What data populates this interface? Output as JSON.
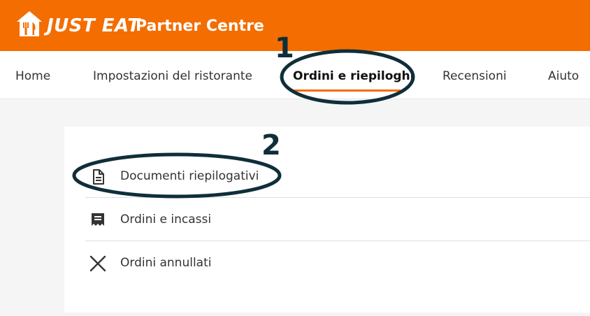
{
  "header": {
    "brand": "JUST EAT",
    "product": "Partner Centre",
    "logo_icon": "house-fork-knife-icon",
    "background_color": "#f36d00"
  },
  "nav": {
    "items": [
      {
        "label": "Home",
        "active": false
      },
      {
        "label": "Impostazioni del ristorante",
        "active": false
      },
      {
        "label": "Ordini e riepiloghi",
        "active": true
      },
      {
        "label": "Recensioni",
        "active": false
      },
      {
        "label": "Aiuto",
        "active": false
      }
    ],
    "accent_color": "#f36d00"
  },
  "menu": {
    "items": [
      {
        "label": "Documenti riepilogativi",
        "icon": "document-icon"
      },
      {
        "label": "Ordini e incassi",
        "icon": "receipt-icon"
      },
      {
        "label": "Ordini annullati",
        "icon": "close-icon"
      }
    ]
  },
  "annotations": {
    "step1": "1",
    "step2": "2",
    "color": "#0f2e3a"
  }
}
